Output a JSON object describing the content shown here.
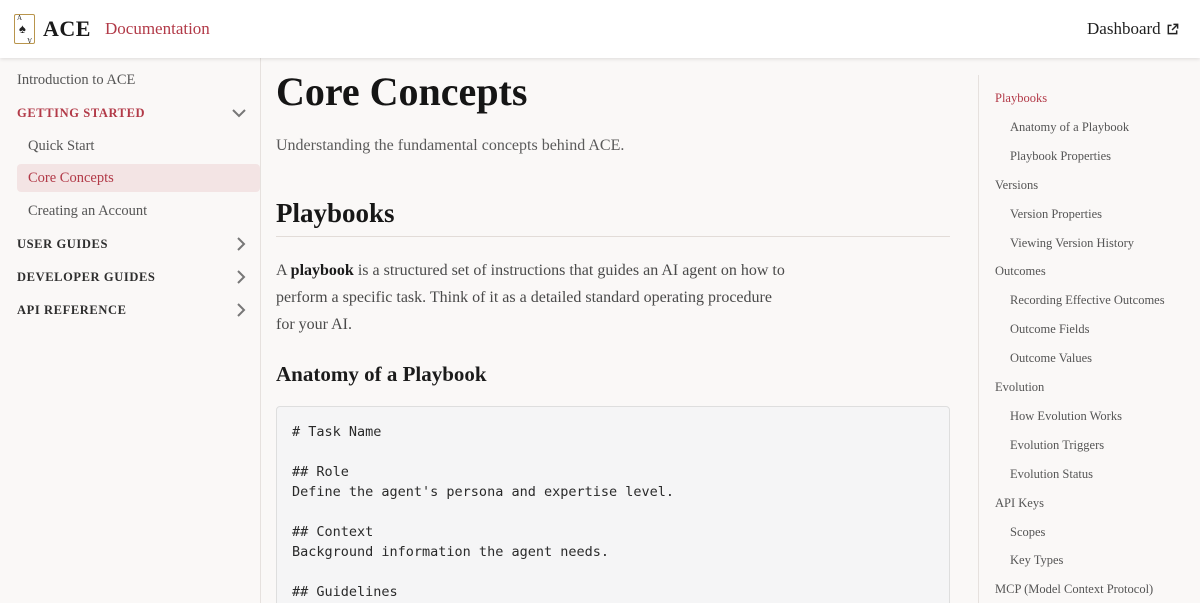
{
  "header": {
    "brand": "ACE",
    "logo_corner": "A",
    "documentation_label": "Documentation",
    "dashboard_label": "Dashboard"
  },
  "sidebar": {
    "intro": "Introduction to ACE",
    "getting_started": "GETTING STARTED",
    "getting_started_items": [
      "Quick Start",
      "Core Concepts",
      "Creating an Account"
    ],
    "active_item": "Core Concepts",
    "user_guides": "USER GUIDES",
    "developer_guides": "DEVELOPER GUIDES",
    "api_reference": "API REFERENCE"
  },
  "main": {
    "title": "Core Concepts",
    "lead": "Understanding the fundamental concepts behind ACE.",
    "section_title": "Playbooks",
    "para_prefix": "A ",
    "para_bold": "playbook",
    "para_rest": " is a structured set of instructions that guides an AI agent on how to perform a specific task. Think of it as a detailed standard operating procedure for your AI.",
    "subsection_title": "Anatomy of a Playbook",
    "code": "# Task Name\n\n## Role\nDefine the agent's persona and expertise level.\n\n## Context\nBackground information the agent needs.\n\n## Guidelines"
  },
  "toc": {
    "items": [
      {
        "label": "Playbooks",
        "level": 1
      },
      {
        "label": "Anatomy of a Playbook",
        "level": 2
      },
      {
        "label": "Playbook Properties",
        "level": 2
      },
      {
        "label": "Versions",
        "level": 1
      },
      {
        "label": "Version Properties",
        "level": 2
      },
      {
        "label": "Viewing Version History",
        "level": 2
      },
      {
        "label": "Outcomes",
        "level": 1
      },
      {
        "label": "Recording Effective Outcomes",
        "level": 2
      },
      {
        "label": "Outcome Fields",
        "level": 2
      },
      {
        "label": "Outcome Values",
        "level": 2
      },
      {
        "label": "Evolution",
        "level": 1
      },
      {
        "label": "How Evolution Works",
        "level": 2
      },
      {
        "label": "Evolution Triggers",
        "level": 2
      },
      {
        "label": "Evolution Status",
        "level": 2
      },
      {
        "label": "API Keys",
        "level": 1
      },
      {
        "label": "Scopes",
        "level": 2
      },
      {
        "label": "Key Types",
        "level": 2
      },
      {
        "label": "MCP (Model Context Protocol)",
        "level": 1
      }
    ],
    "active": "Playbooks"
  },
  "colors": {
    "accent": "#b23a48",
    "active_bg": "#f3e4e4",
    "page_bg": "#faf8f7"
  },
  "icons": [
    "spade-card-logo-icon",
    "external-link-icon",
    "chevron-down-icon",
    "chevron-right-icon"
  ]
}
